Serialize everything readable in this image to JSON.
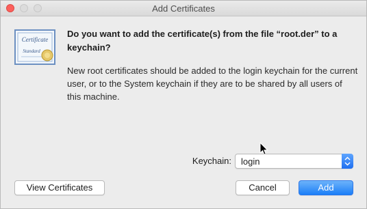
{
  "window": {
    "title": "Add Certificates"
  },
  "dialog": {
    "heading": "Do you want to add the certificate(s) from the file “root.der” to a keychain?",
    "message": "New root certificates should be added to the login keychain for the current user, or to the System keychain if they are to be shared by all users of this machine.",
    "icon": "certificate-icon",
    "certificate_icon_text": {
      "line1": "Certificate",
      "line2": "Standard"
    }
  },
  "keychain": {
    "label": "Keychain:",
    "selected": "login"
  },
  "buttons": {
    "view_certificates": "View Certificates",
    "cancel": "Cancel",
    "add": "Add"
  },
  "colors": {
    "accent": "#1b7ef7",
    "close_button": "#fc605c",
    "window_bg": "#ececec"
  }
}
